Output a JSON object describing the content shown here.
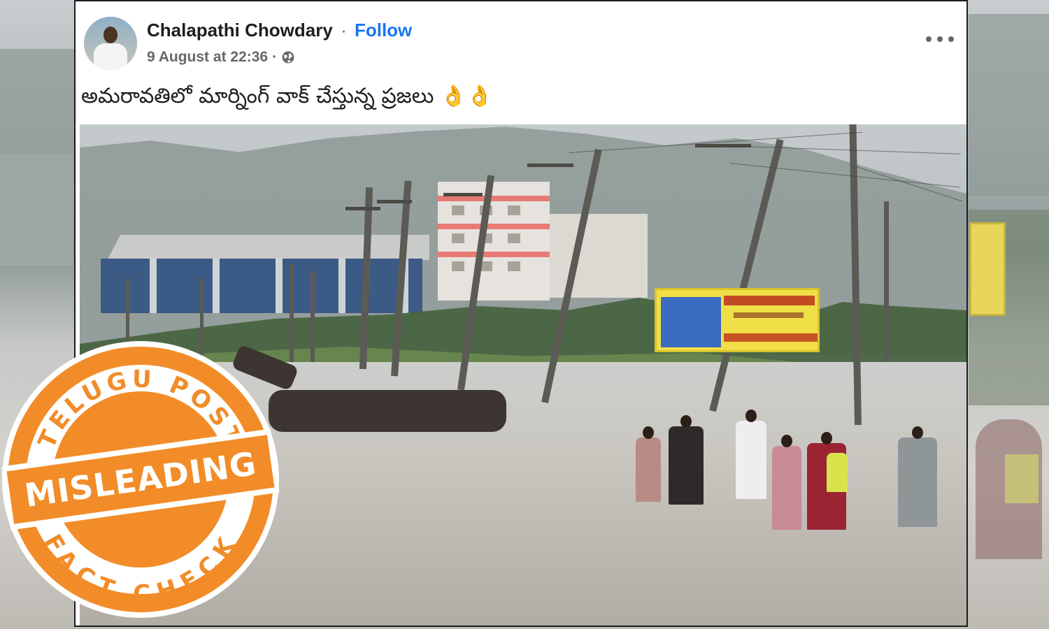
{
  "post": {
    "author": "Chalapathi Chowdary",
    "separator": "·",
    "follow_label": "Follow",
    "timestamp": "9 August at 22:36",
    "meta_separator": "·",
    "privacy_icon": "globe-icon",
    "more_icon": "more-options-icon",
    "caption": "అమరావతిలో మార్నింగ్ వాక్ చేస్తున్న ప్రజలు 👌👌"
  },
  "stamp": {
    "top_text": "TELUGU POST",
    "label": "MISLEADING",
    "bottom_text": "FACT CHECK",
    "color": "#f28c28"
  },
  "colors": {
    "link": "#1877f2",
    "text": "#1c1e21",
    "secondary": "#65676b"
  }
}
